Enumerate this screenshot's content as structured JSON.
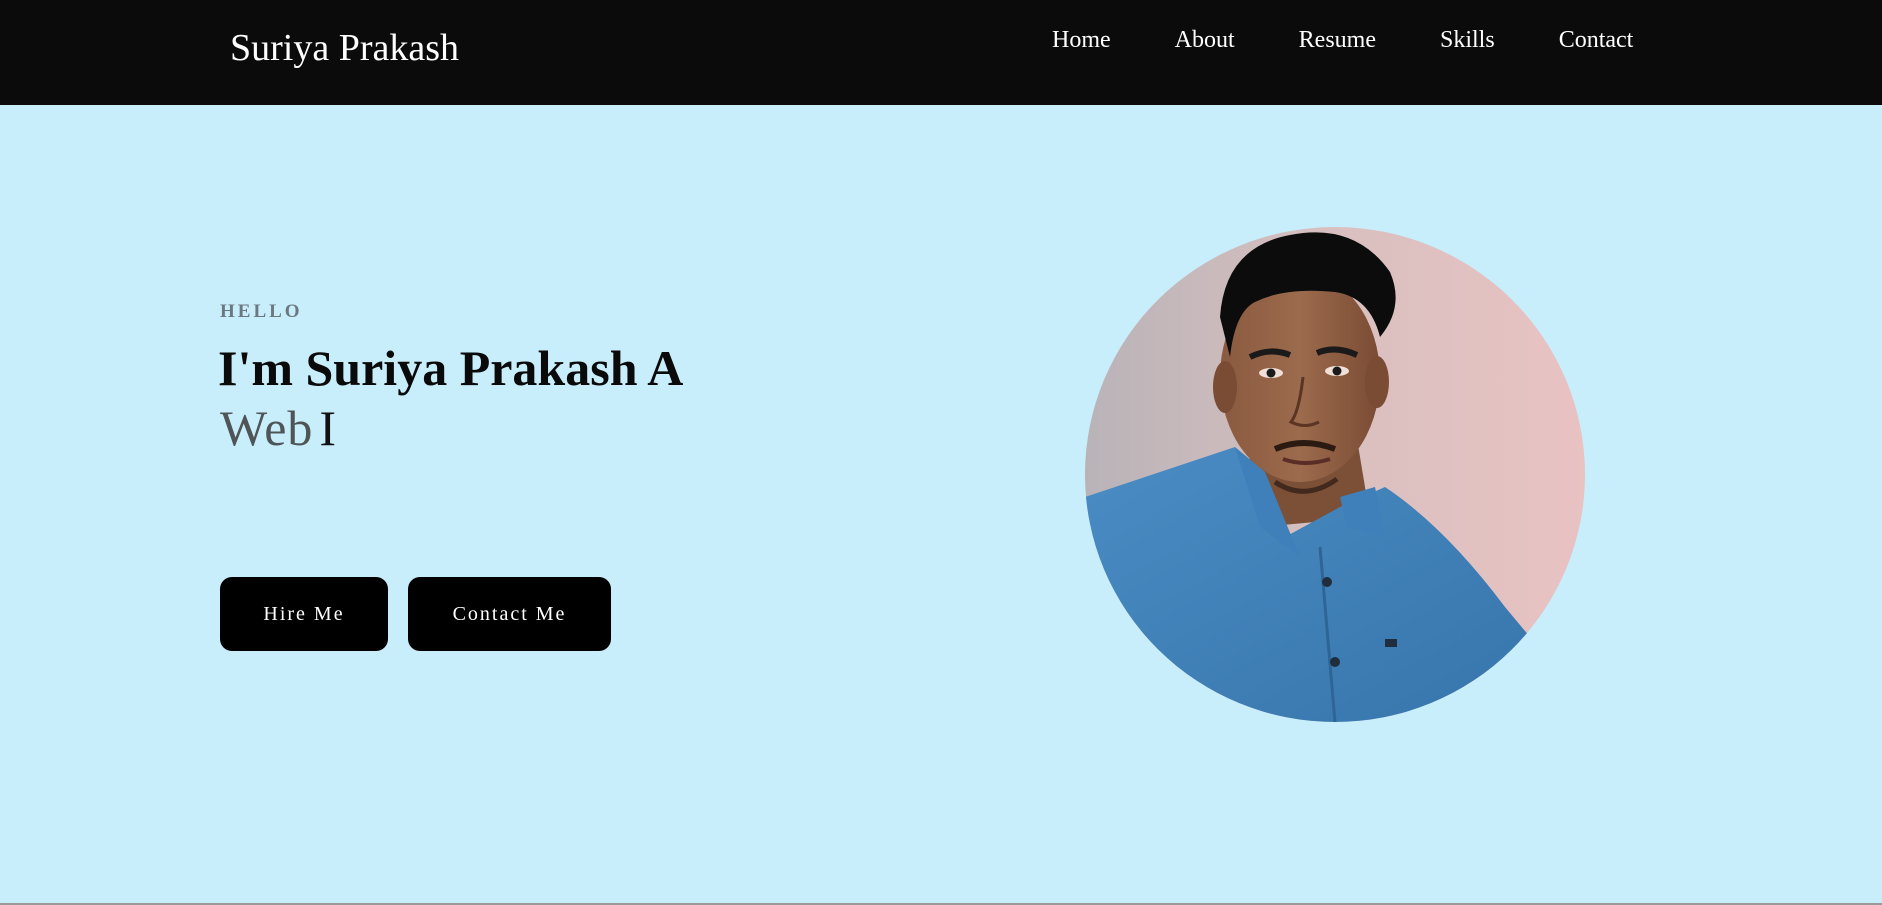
{
  "header": {
    "brand": "Suriya Prakash",
    "nav": [
      {
        "label": "Home"
      },
      {
        "label": "About"
      },
      {
        "label": "Resume"
      },
      {
        "label": "Skills"
      },
      {
        "label": "Contact"
      }
    ]
  },
  "hero": {
    "greeting": "HELLO",
    "intro": "I'm",
    "name": "Suriya Prakash A",
    "typed_text": "Web",
    "cursor": "I",
    "buttons": {
      "hire": "Hire Me",
      "contact": "Contact Me"
    }
  },
  "colors": {
    "navbar_bg": "#0b0b0b",
    "hero_bg": "#c8eefc",
    "button_bg": "#000000",
    "greeting_text": "#6b7880"
  }
}
